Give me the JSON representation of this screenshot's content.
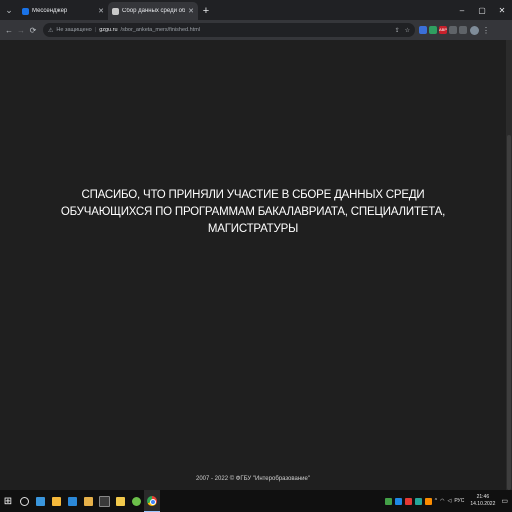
{
  "browser": {
    "tabs": [
      {
        "title": "Мессенджер",
        "favicon_color": "#1a73e8",
        "active": false
      },
      {
        "title": "Сбор данных среди обучающ",
        "favicon_color": "#c9c9c9",
        "active": true
      }
    ],
    "new_tab_label": "+",
    "window_controls": {
      "minimize": "–",
      "maximize": "▢",
      "close": "✕"
    },
    "address_bar": {
      "security_label": "Не защищено",
      "host": "gzgu.ru",
      "path": "/sbor_anketa_mers/finished.html"
    },
    "extensions": [
      {
        "name": "ext-blue",
        "color": "#3b6fd8"
      },
      {
        "name": "ext-green",
        "color": "#2f9e60"
      },
      {
        "name": "ext-abp",
        "label": "ABP",
        "color": "#c7202b"
      },
      {
        "name": "ext-gray",
        "color": "#5f6368"
      },
      {
        "name": "ext-puzzle",
        "color": "#5f6368"
      }
    ]
  },
  "page": {
    "message": "СПАСИБО, ЧТО ПРИНЯЛИ УЧАСТИЕ В СБОРЕ ДАННЫХ СРЕДИ ОБУЧАЮЩИХСЯ ПО ПРОГРАММАМ БАКАЛАВРИАТА, СПЕЦИАЛИТЕТА, МАГИСТРАТУРЫ",
    "footer": "2007 - 2022 © ФГБУ \"Интеробразование\""
  },
  "taskbar": {
    "language": "РУС",
    "time": "21:46",
    "date": "14.10.2022",
    "pinned": [
      {
        "name": "task-view",
        "color": "#3a96dd"
      },
      {
        "name": "app-explorer-yellow",
        "color": "#f6b93b"
      },
      {
        "name": "app-mail",
        "color": "#2b88d8"
      },
      {
        "name": "app-folder",
        "color": "#e7b14a"
      },
      {
        "name": "app-terminal",
        "color": "#3a3a3a"
      },
      {
        "name": "app-files",
        "color": "#f2c94c"
      },
      {
        "name": "app-green",
        "color": "#6cc04a"
      }
    ],
    "tray_icons": [
      {
        "name": "tray-green",
        "color": "#43a047"
      },
      {
        "name": "tray-blue",
        "color": "#1e88e5"
      },
      {
        "name": "tray-red",
        "color": "#e53935"
      },
      {
        "name": "tray-teal",
        "color": "#26a69a"
      },
      {
        "name": "tray-orange",
        "color": "#fb8c00"
      }
    ]
  }
}
